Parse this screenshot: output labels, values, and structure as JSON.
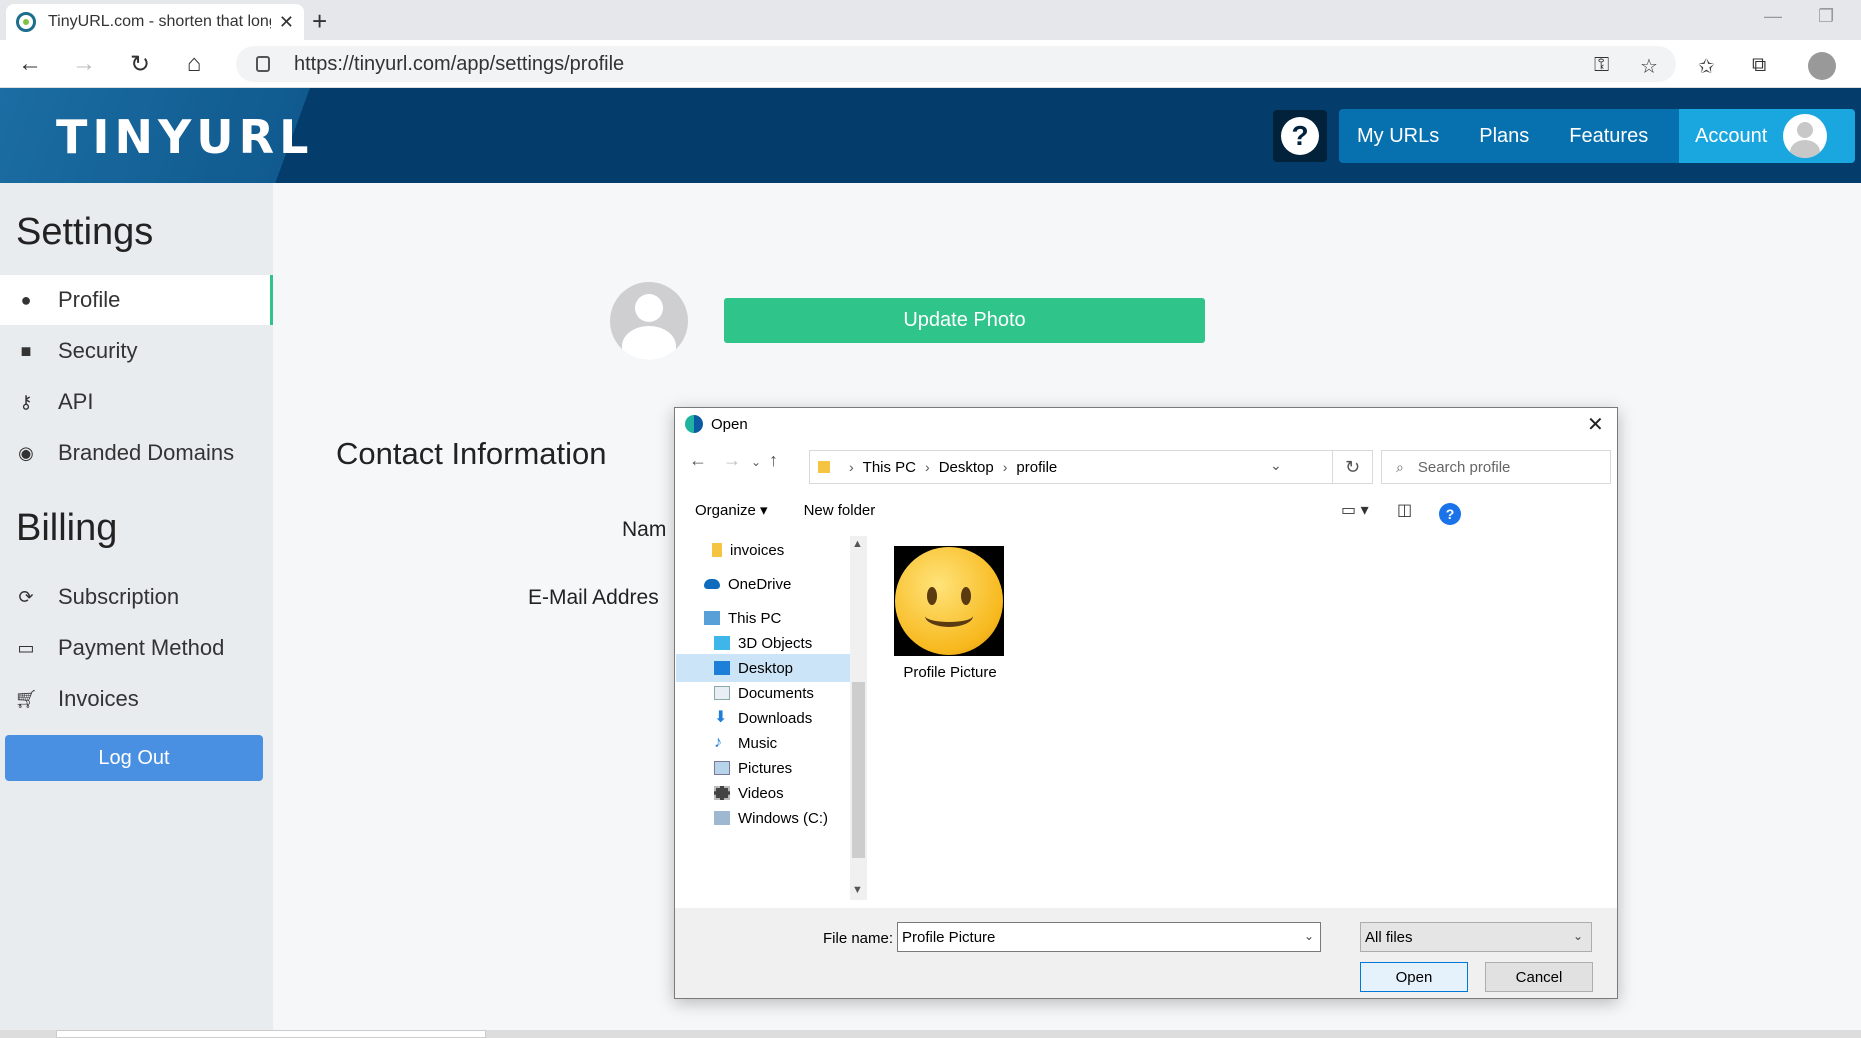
{
  "browser": {
    "tab_title": "TinyURL.com - shorten that long",
    "url": "https://tinyurl.com/app/settings/profile"
  },
  "site": {
    "logo": "TINYURL",
    "nav": {
      "help": "?",
      "my_urls": "My URLs",
      "plans": "Plans",
      "features": "Features",
      "account": "Account"
    }
  },
  "sidebar": {
    "settings_heading": "Settings",
    "settings_items": [
      {
        "label": "Profile",
        "icon": "user-icon"
      },
      {
        "label": "Security",
        "icon": "lock-icon"
      },
      {
        "label": "API",
        "icon": "key-icon"
      },
      {
        "label": "Branded Domains",
        "icon": "globe-icon"
      }
    ],
    "billing_heading": "Billing",
    "billing_items": [
      {
        "label": "Subscription",
        "icon": "refresh-icon"
      },
      {
        "label": "Payment Method",
        "icon": "credit-card-icon"
      },
      {
        "label": "Invoices",
        "icon": "cart-icon"
      }
    ],
    "logout": "Log Out"
  },
  "main": {
    "update_photo": "Update Photo",
    "contact_title": "Contact Information",
    "name_label": "Nam",
    "email_label": "E-Mail Addres"
  },
  "dialog": {
    "title": "Open",
    "breadcrumb": [
      "This PC",
      "Desktop",
      "profile"
    ],
    "search_placeholder": "Search profile",
    "organize": "Organize ▾",
    "new_folder": "New folder",
    "help": "?",
    "tree": [
      {
        "label": "invoices",
        "selected": false
      },
      {
        "label": "OneDrive",
        "selected": false
      },
      {
        "label": "This PC",
        "selected": false
      },
      {
        "label": "3D Objects",
        "selected": false
      },
      {
        "label": "Desktop",
        "selected": true
      },
      {
        "label": "Documents",
        "selected": false
      },
      {
        "label": "Downloads",
        "selected": false
      },
      {
        "label": "Music",
        "selected": false
      },
      {
        "label": "Pictures",
        "selected": false
      },
      {
        "label": "Videos",
        "selected": false
      },
      {
        "label": "Windows (C:)",
        "selected": false
      }
    ],
    "file": {
      "label": "Profile Picture"
    },
    "file_name_label": "File name:",
    "file_name_value": "Profile Picture",
    "file_type": "All files",
    "open_button": "Open",
    "cancel_button": "Cancel"
  },
  "colors": {
    "header_bg": "#043c6c",
    "accent_green": "#2ec48a",
    "logout_blue": "#4a90e2",
    "account_blue": "#1aa7e0"
  }
}
